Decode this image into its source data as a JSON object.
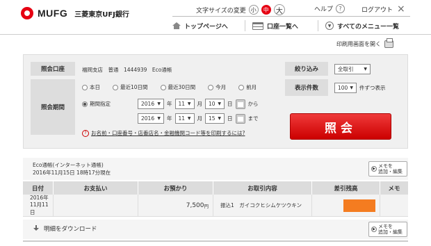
{
  "header": {
    "logo_text": "MUFG",
    "bank_name": "三菱東京UFJ銀行",
    "font_size_label": "文字サイズの変更",
    "font_sizes": [
      "小",
      "中",
      "大"
    ],
    "help": "ヘルプ",
    "help_icon": "?",
    "logout": "ログアウト",
    "close_icon": "×"
  },
  "nav": {
    "top": "トップページへ",
    "accounts": "口座一覧へ",
    "all_menu": "すべてのメニュー一覧"
  },
  "print_link": "印刷用画面を開く",
  "search": {
    "account_label": "照会口座",
    "account_value": "福岡支店　普通　1444939　Eco通帳",
    "period_label": "照会期間",
    "period_options": [
      "本日",
      "最近10日間",
      "最近30日間",
      "今月",
      "前月"
    ],
    "period_custom": "期間指定",
    "from": {
      "year": "2016",
      "month": "11",
      "day": "10"
    },
    "to": {
      "year": "2016",
      "month": "11",
      "day": "15"
    },
    "unit_year": "年",
    "unit_month": "月",
    "unit_day": "日",
    "from_suffix": "から",
    "to_suffix": "まで",
    "help_link": "お名前・口座番号・店番店名・金融機関コード等を印刷するには?",
    "filter_label": "絞り込み",
    "filter_value": "全取引",
    "count_label": "表示件数",
    "count_value": "100",
    "count_suffix": "件ずつ表示",
    "submit": "照会"
  },
  "results": {
    "account_title": "Eco通帳(インターネット通帳)",
    "timestamp": "2016年11月15日 18時17分現在",
    "memo_button": [
      "メモを",
      "追加・編集"
    ],
    "columns": [
      "日付",
      "お支払い",
      "お預かり",
      "お取引内容",
      "差引残高",
      "メモ"
    ],
    "rows": [
      {
        "date": [
          "2016年",
          "11月11日"
        ],
        "payment": "",
        "deposit": "7,500",
        "deposit_unit": "円",
        "content": "振込1　ガイコクヒシムケツウキン",
        "balance_redacted_color": "#f47c20",
        "memo": ""
      }
    ],
    "download": "明細をダウンロード"
  }
}
